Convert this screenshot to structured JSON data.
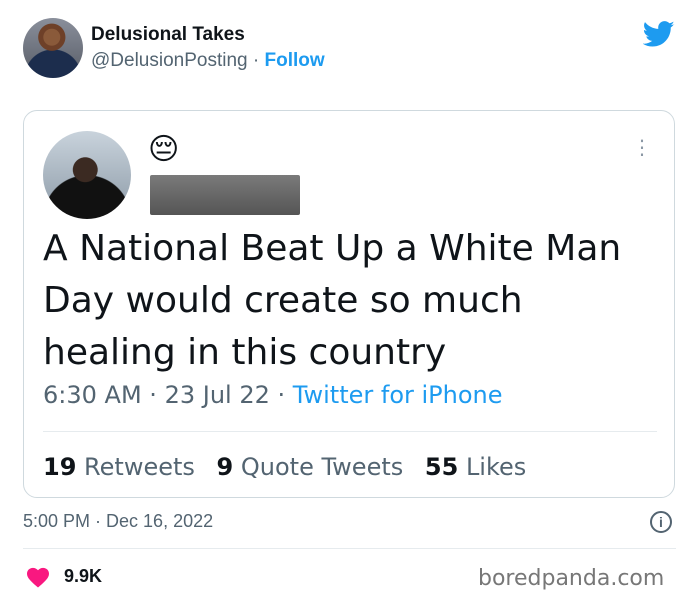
{
  "author": {
    "name": "Delusional Takes",
    "handle": "@DelusionPosting",
    "separator": "·",
    "follow_label": "Follow"
  },
  "icons": {
    "brand": "twitter-bird-icon",
    "more": "more-options-icon",
    "info": "info-icon",
    "like": "heart-icon",
    "brand_color": "#1d9bf0",
    "like_color": "#f91880"
  },
  "quoted_tweet": {
    "emoji": "😔",
    "text": "A National Beat Up a White Man Day would create so much healing in this country",
    "time": "6:30 AM",
    "date": "23 Jul 22",
    "source": "Twitter for iPhone",
    "separator": "·",
    "retweets_count": "19",
    "retweets_label": "Retweets",
    "quotes_count": "9",
    "quotes_label": "Quote Tweets",
    "likes_count": "55",
    "likes_label": "Likes"
  },
  "post": {
    "timestamp": "5:00 PM · Dec 16, 2022",
    "like_count": "9.9K"
  },
  "watermark": "boredpanda.com"
}
